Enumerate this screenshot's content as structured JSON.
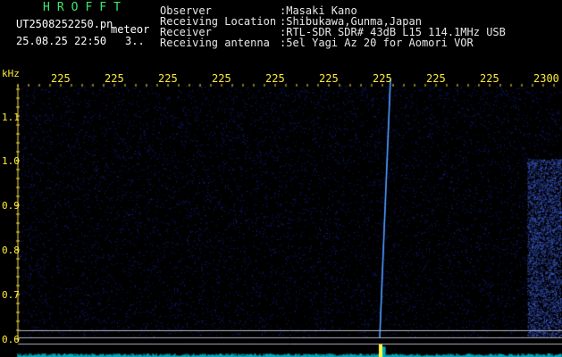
{
  "header": {
    "program": "HROFFT",
    "filename": "UT2508252250.pn",
    "event_label": "meteor",
    "datetime": "25.08.25 22:50",
    "counter": "3..",
    "fields": [
      {
        "label": "Observer",
        "value": ":Masaki Kano"
      },
      {
        "label": "Receiving Location",
        "value": ":Shibukawa,Gunma,Japan"
      },
      {
        "label": "Receiver",
        "value": ":RTL-SDR SDR# 43dB L15 114.1MHz USB"
      },
      {
        "label": "Receiving antenna",
        "value": ":5el Yagi Az 20 for Aomori VOR"
      }
    ]
  },
  "axis": {
    "unit": "kHz",
    "time_ticks": [
      "225",
      "225",
      "225",
      "225",
      "225",
      "225",
      "225",
      "225",
      "225",
      "2300"
    ],
    "freq_ticks": [
      "1.1",
      "1.0",
      "0.9",
      "0.8",
      "0.7",
      "0.6"
    ]
  },
  "colors": {
    "background": "#000000",
    "noise": "#1a2a8c",
    "trace": "#2f7dff",
    "axis_text": "#ffeb3b",
    "title_green": "#3ee86a",
    "baseline": "#00e5ff",
    "guide_line": "#b0b0c0"
  }
}
